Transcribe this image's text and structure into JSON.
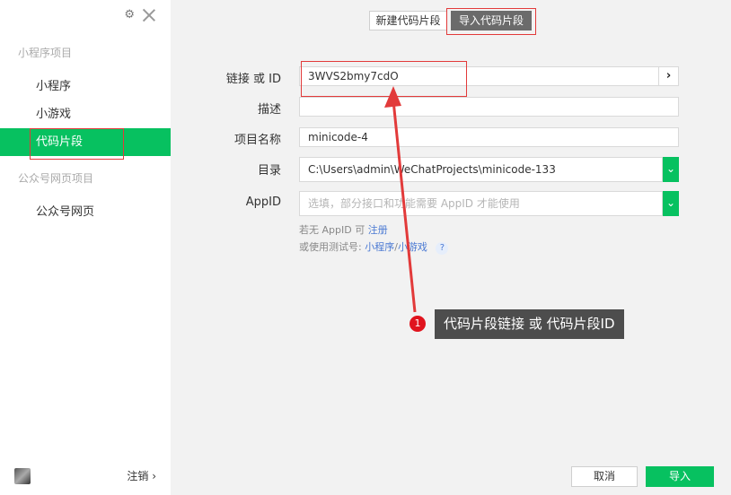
{
  "sidebar": {
    "section_miniprogram": "小程序项目",
    "items_miniprogram": [
      "小程序",
      "小游戏",
      "代码片段"
    ],
    "section_official": "公众号网页项目",
    "items_official": [
      "公众号网页"
    ],
    "footer_logout": "注销 ›"
  },
  "tabs": {
    "new": "新建代码片段",
    "import": "导入代码片段",
    "active": "导入代码片段"
  },
  "form": {
    "link_label": "链接 或 ID",
    "link_value": "3WVS2bmy7cdO",
    "desc_label": "描述",
    "desc_value": "",
    "name_label": "项目名称",
    "name_value": "minicode-4",
    "dir_label": "目录",
    "dir_value": "C:\\Users\\admin\\WeChatProjects\\minicode-133",
    "appid_label": "AppID",
    "appid_placeholder": "选填，部分接口和功能需要 AppID 才能使用",
    "hint_no_appid": "若无 AppID 可",
    "hint_register": "注册",
    "hint_test": "或使用测试号:",
    "hint_mini": "小程序",
    "hint_sep": "/",
    "hint_game": "小游戏",
    "hint_q": "?"
  },
  "annotation": {
    "badge": "1",
    "text": "代码片段链接 或 代码片段ID"
  },
  "buttons": {
    "cancel": "取消",
    "import": "导入"
  },
  "icons": {
    "settings": "gear-icon",
    "close": "close-icon",
    "go": "chevron-right-icon",
    "dropdown": "chevron-down-icon"
  },
  "colors": {
    "accent": "#07c160",
    "highlight": "#e23a3a",
    "callout_bg": "#4d4d4d",
    "link": "#4b7ad3"
  }
}
